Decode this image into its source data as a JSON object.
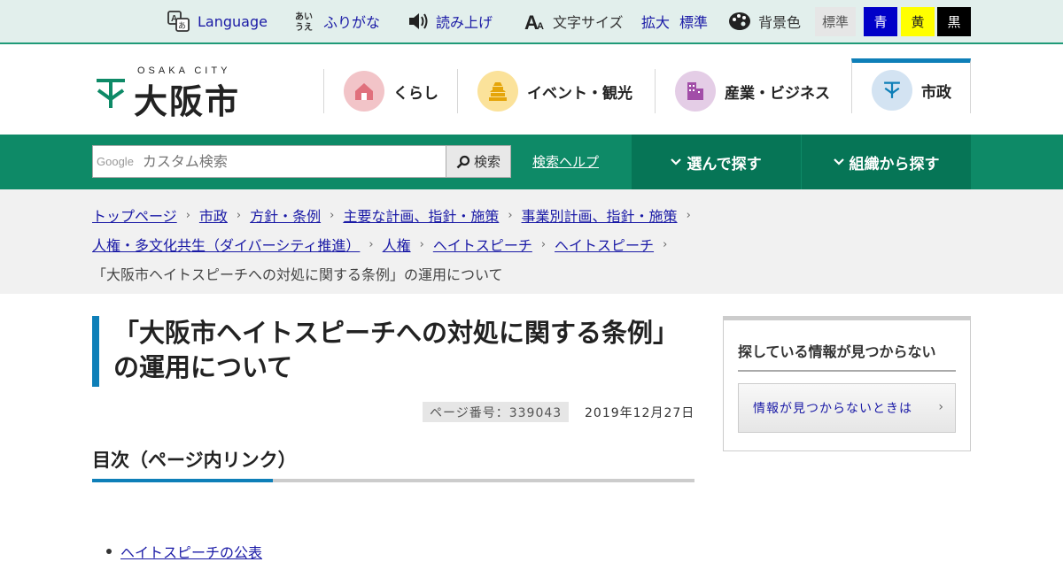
{
  "utility": {
    "language": "Language",
    "furigana": "ふりがな",
    "read_aloud": "読み上げ",
    "text_size_label": "文字サイズ",
    "text_enlarge": "拡大",
    "text_standard": "標準",
    "bg_label": "背景色",
    "bg_options": [
      "標準",
      "青",
      "黄",
      "黒"
    ]
  },
  "logo": {
    "sub": "OSAKA CITY",
    "main": "大阪市"
  },
  "nav": [
    {
      "label": "くらし",
      "icon": "house-icon",
      "color": "#f2c4c8"
    },
    {
      "label": "イベント・観光",
      "icon": "castle-icon",
      "color": "#fbe29a"
    },
    {
      "label": "産業・ビジネス",
      "icon": "building-icon",
      "color": "#e4cde6"
    },
    {
      "label": "市政",
      "icon": "city-emblem-icon",
      "color": "#d3e3f2"
    }
  ],
  "search": {
    "google": "Google",
    "placeholder": "カスタム検索",
    "button": "検索",
    "help": "検索ヘルプ",
    "choose": "選んで探す",
    "org": "組織から探す"
  },
  "breadcrumb": {
    "line1": [
      "トップページ",
      "市政",
      "方針・条例",
      "主要な計画、指針・施策",
      "事業別計画、指針・施策"
    ],
    "line2": [
      "人権・多文化共生（ダイバーシティ推進）",
      "人権",
      "ヘイトスピーチ",
      "ヘイトスピーチ"
    ],
    "current": "「大阪市ヘイトスピーチへの対処に関する条例」の運用について"
  },
  "page": {
    "title": "「大阪市ヘイトスピーチへの対処に関する条例」の運用について",
    "page_number": "ページ番号：339043",
    "date": "2019年12月27日",
    "toc_heading": "目次（ページ内リンク）",
    "toc_items": [
      "ヘイトスピーチの公表"
    ]
  },
  "sidebar": {
    "heading": "探している情報が見つからない",
    "button": "情報が見つからないときは"
  },
  "colors": {
    "brand_green": "#0e8a67",
    "accent_blue": "#0e7fb8",
    "link": "#1a1aa6"
  }
}
